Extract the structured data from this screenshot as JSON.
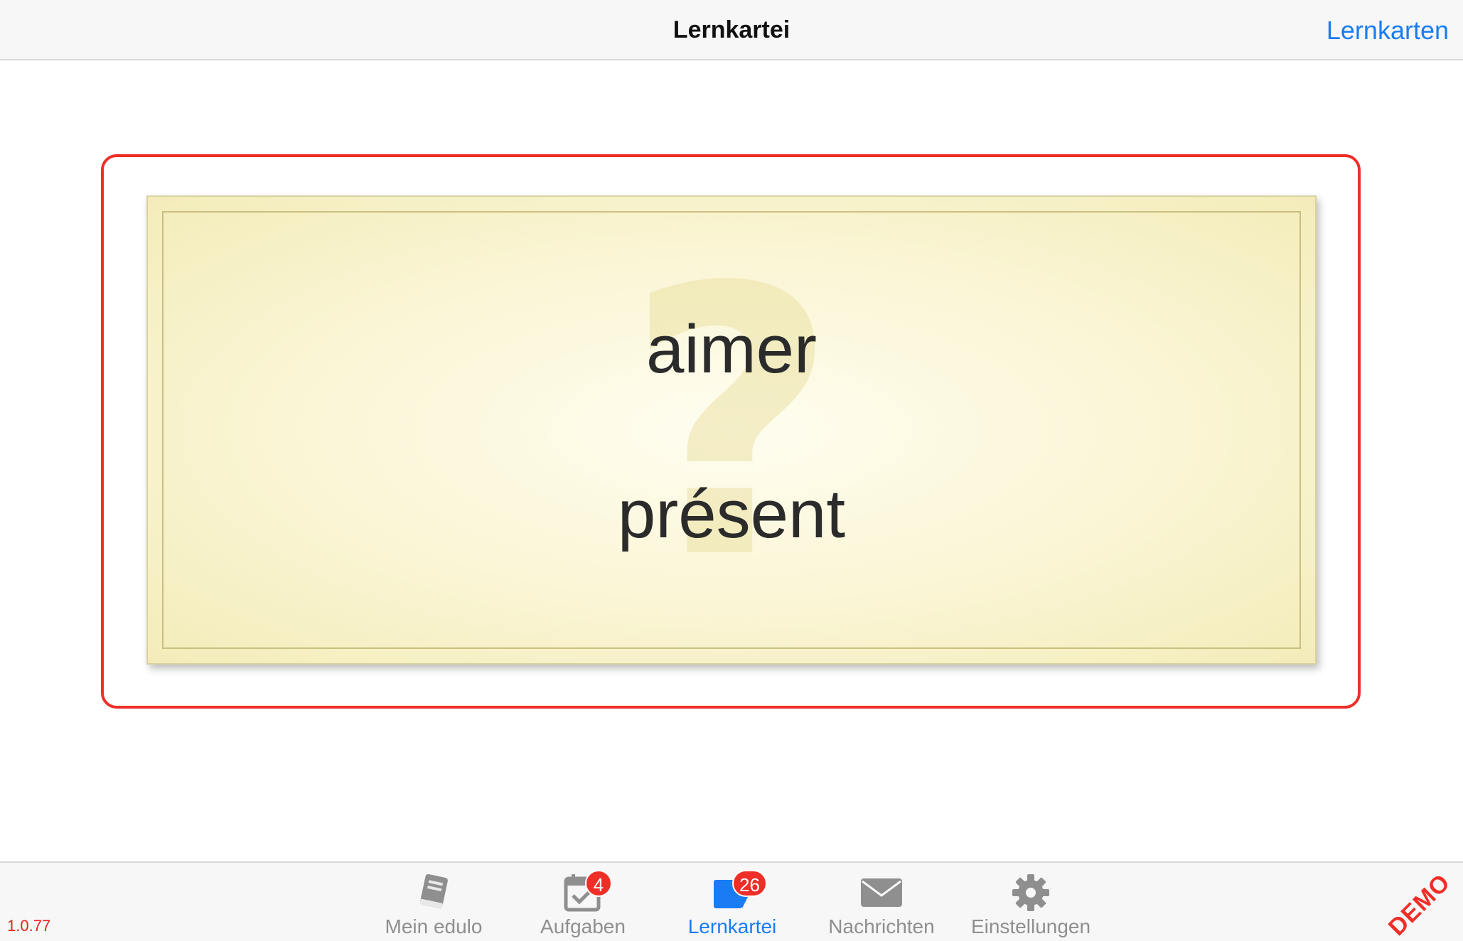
{
  "navbar": {
    "title": "Lernkartei",
    "right_button": "Lernkarten"
  },
  "card": {
    "front_text": "aimer",
    "back_text": "présent",
    "watermark": "?"
  },
  "tabbar": {
    "version": "1.0.77",
    "demo_label": "DEMO",
    "tabs": [
      {
        "label": "Mein edulo",
        "icon": "book-icon",
        "badge": ""
      },
      {
        "label": "Aufgaben",
        "icon": "calendar-check-icon",
        "badge": "4"
      },
      {
        "label": "Lernkartei",
        "icon": "flashcard-icon",
        "badge": "26",
        "active": true
      },
      {
        "label": "Nachrichten",
        "icon": "envelope-icon",
        "badge": ""
      },
      {
        "label": "Einstellungen",
        "icon": "gear-icon",
        "badge": ""
      }
    ]
  },
  "colors": {
    "accent": "#1a7cf2",
    "inactive_tab": "#8f8f8f",
    "highlight_frame": "#ef2e28",
    "card_background": "#faf5d4"
  }
}
